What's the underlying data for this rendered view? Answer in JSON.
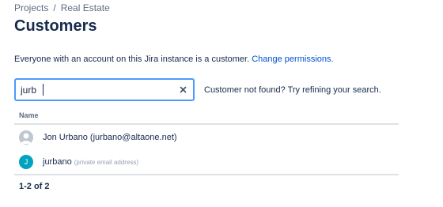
{
  "breadcrumb": {
    "items": [
      "Projects",
      "Real Estate"
    ],
    "separator": "/"
  },
  "page": {
    "title": "Customers"
  },
  "info": {
    "text": "Everyone with an account on this Jira instance is a customer. ",
    "link": "Change permissions."
  },
  "search": {
    "value": "jurb",
    "placeholder": "",
    "clear_icon": "close-icon"
  },
  "search_message": "Customer not found? Try refining your search.",
  "table": {
    "columns": [
      "Name"
    ],
    "rows": [
      {
        "avatar": "default-user-icon",
        "name": "Jon Urbano (jurbano@altaone.net)",
        "sub": ""
      },
      {
        "avatar": "J",
        "name": "jurbano",
        "sub": "(private email address)"
      }
    ]
  },
  "pagination": "1-2 of 2",
  "colors": {
    "text": "#172b4d",
    "muted": "#5e6c84",
    "link": "#0052cc",
    "focus_border": "#4c9aff",
    "avatar_teal": "#00a3bf"
  }
}
